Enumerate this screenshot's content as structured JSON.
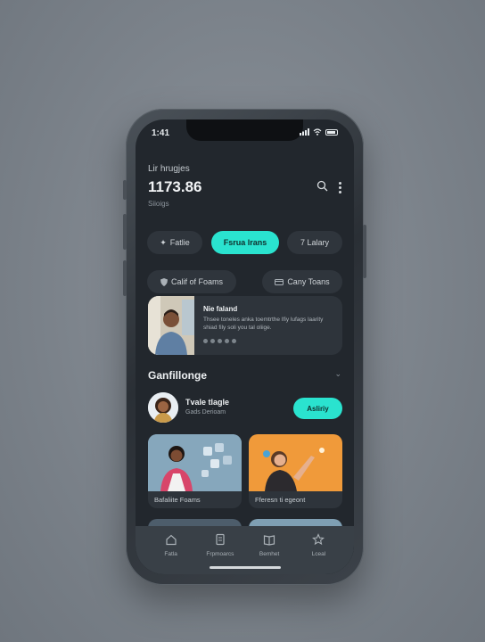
{
  "status": {
    "time": "1:41"
  },
  "header": {
    "title": "Lir hrugjes",
    "amount": "1173.86",
    "subtitle": "Siioigs"
  },
  "chips_row1": [
    {
      "label": "Fatlie",
      "icon": "sparkle-icon"
    },
    {
      "label": "Fsrua lrans",
      "active": true
    },
    {
      "label": "7 Lalary"
    }
  ],
  "chips_row2": [
    {
      "label": "Calif of Foams",
      "icon": "shield-icon"
    },
    {
      "label": "Cany Toans",
      "icon": "card-icon"
    }
  ],
  "feature_card": {
    "title": "Nie faland",
    "text": "Thsee toneles anka toemtrthe Ifiy lufags laarity shiad fily soli you tal oliige."
  },
  "section": {
    "title": "Ganfillonge",
    "chevron": "chevron-down-icon"
  },
  "user": {
    "name": "Tvale tlagle",
    "sub": "Gads Derioam",
    "button": "Asliriy"
  },
  "tiles": [
    {
      "label": "Bafaliite Foams"
    },
    {
      "label": "Fferesn ti egeont"
    }
  ],
  "tabs": [
    {
      "label": "Fatla",
      "icon": "home-icon"
    },
    {
      "label": "Frpmoarcs",
      "icon": "document-icon"
    },
    {
      "label": "Bemhet",
      "icon": "book-icon"
    },
    {
      "label": "Lceal",
      "icon": "star-icon"
    }
  ],
  "colors": {
    "accent": "#2ae3cf",
    "screen_bg": "#22272d",
    "card_bg": "#2e343b",
    "backdrop": "#7a8189"
  }
}
